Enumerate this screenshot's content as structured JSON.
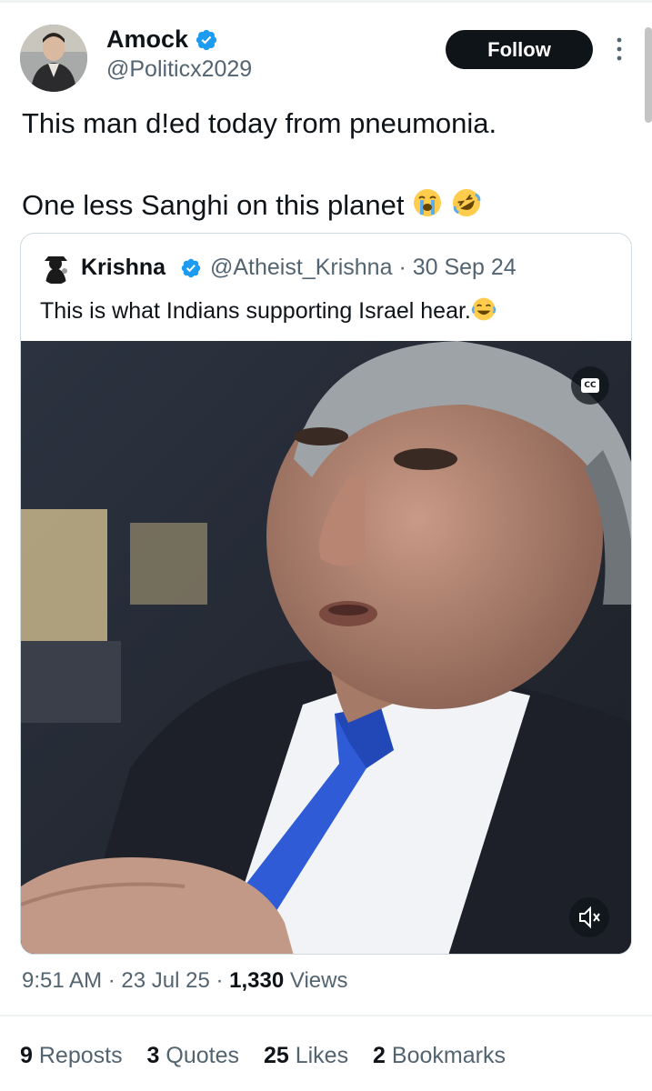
{
  "author": {
    "name": "Amock",
    "handle": "@Politicx2029",
    "verified": true
  },
  "follow_label": "Follow",
  "tweet": {
    "line1": "This man d!ed today from pneumonia.",
    "line2": "One less Sanghi on this planet",
    "line2_emojis": [
      "loudly-crying-face",
      "rolling-on-the-floor-laughing"
    ]
  },
  "quote": {
    "name": "Krishna",
    "handle": "@Atheist_Krishna",
    "separator": "·",
    "date": "30 Sep 24",
    "text": "This is what Indians supporting Israel hear.",
    "text_emoji": "face-with-tears-of-joy",
    "video": {
      "cc_label": "CC",
      "mute_icon": "volume-muted-icon"
    }
  },
  "meta": {
    "time": "9:51 AM",
    "sep1": "·",
    "date": "23 Jul 25",
    "sep2": "·",
    "views_count": "1,330",
    "views_label": "Views"
  },
  "stats": [
    {
      "count": "9",
      "label": "Reposts"
    },
    {
      "count": "3",
      "label": "Quotes"
    },
    {
      "count": "25",
      "label": "Likes"
    },
    {
      "count": "2",
      "label": "Bookmarks"
    }
  ],
  "colors": {
    "text": "#0f1419",
    "secondary": "#536471",
    "verified": "#1d9bf0",
    "border": "#cfd9de",
    "follow_bg": "#0f1419",
    "tie": "#2f5bd6"
  }
}
